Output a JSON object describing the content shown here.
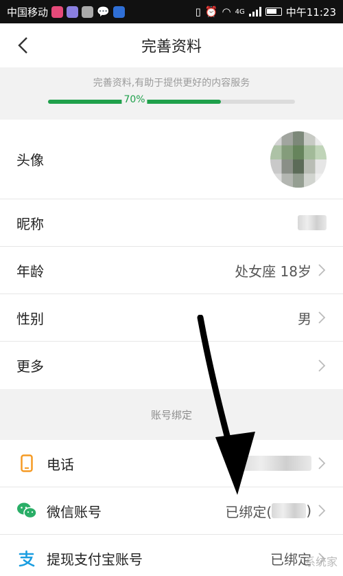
{
  "statusbar": {
    "carrier": "中国移动",
    "time": "中午11:23",
    "network": "4G"
  },
  "nav": {
    "title": "完善资料"
  },
  "progress": {
    "tip": "完善资料,有助于提供更好的内容服务",
    "percent_label": "70%",
    "percent": 70
  },
  "profile": {
    "avatar_label": "头像",
    "nickname_label": "昵称",
    "age_label": "年龄",
    "age_value": "处女座 18岁",
    "gender_label": "性别",
    "gender_value": "男",
    "more_label": "更多"
  },
  "binding": {
    "section_title": "账号绑定",
    "phone_label": "电话",
    "wechat_label": "微信账号",
    "wechat_value": "已绑定(",
    "wechat_value_end": ")",
    "alipay_label": "提现支付宝账号",
    "alipay_value": "已绑定"
  },
  "colors": {
    "accent": "#1fa04b",
    "phone_icon": "#f59a23",
    "wechat_icon": "#2aae67",
    "alipay_icon": "#1a9de0"
  },
  "watermark": "系统家"
}
